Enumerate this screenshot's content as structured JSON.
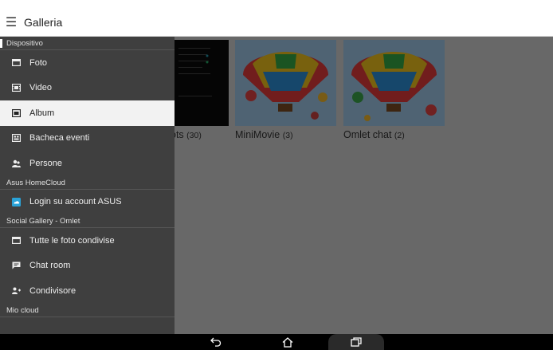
{
  "app": {
    "title": "Galleria",
    "menu_icon": "hamburger-icon"
  },
  "albums": [
    {
      "name": "ots",
      "count": "(30)"
    },
    {
      "name": "MiniMovie",
      "count": "(3)"
    },
    {
      "name": "Omlet chat",
      "count": "(2)"
    }
  ],
  "drawer": {
    "sections": [
      {
        "title": "Dispositivo",
        "items": [
          {
            "label": "Foto",
            "icon": "photo-icon"
          },
          {
            "label": "Video",
            "icon": "video-icon"
          },
          {
            "label": "Album",
            "icon": "album-icon",
            "selected": true
          },
          {
            "label": "Bacheca eventi",
            "icon": "event-board-icon"
          },
          {
            "label": "Persone",
            "icon": "people-icon"
          }
        ]
      },
      {
        "title": "Asus HomeCloud",
        "items": [
          {
            "label": "Login su account ASUS",
            "icon": "cloud-login-icon"
          }
        ]
      },
      {
        "title": "Social Gallery - Omlet",
        "items": [
          {
            "label": "Tutte le foto condivise",
            "icon": "shared-photos-icon"
          },
          {
            "label": "Chat room",
            "icon": "chat-icon"
          },
          {
            "label": "Condivisore",
            "icon": "sharer-icon"
          }
        ]
      },
      {
        "title": "Mio cloud",
        "items": []
      }
    ]
  },
  "navbar": {
    "back_icon": "back-icon",
    "home_icon": "home-icon",
    "recents_icon": "recents-icon"
  },
  "colors": {
    "drawer_bg": "#3f3f3f",
    "selected_bg": "#f2f2f2",
    "appbar_bg": "#ffffff",
    "scrim": "rgba(0,0,0,0.5)"
  }
}
